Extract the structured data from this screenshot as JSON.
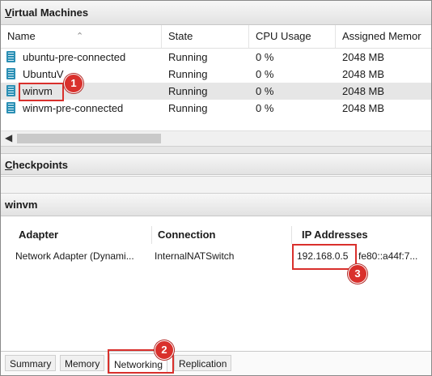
{
  "vm_pane": {
    "title_first": "V",
    "title_rest": "irtual Machines",
    "columns": [
      "Name",
      "State",
      "CPU Usage",
      "Assigned Memor"
    ],
    "rows": [
      {
        "name": "ubuntu-pre-connected",
        "state": "Running",
        "cpu": "0 %",
        "memory": "2048 MB"
      },
      {
        "name": "UbuntuV",
        "state": "Running",
        "cpu": "0 %",
        "memory": "2048 MB"
      },
      {
        "name": "winvm",
        "state": "Running",
        "cpu": "0 %",
        "memory": "2048 MB"
      },
      {
        "name": "winvm-pre-connected",
        "state": "Running",
        "cpu": "0 %",
        "memory": "2048 MB"
      }
    ],
    "selected_index": 2
  },
  "checkpoints_pane": {
    "title_first": "C",
    "title_rest": "heckpoints"
  },
  "details": {
    "title": "winvm",
    "columns": [
      "Adapter",
      "Connection",
      "IP Addresses"
    ],
    "adapter": "Network Adapter (Dynami...",
    "connection": "InternalNATSwitch",
    "ipv4": "192.168.0.5",
    "ipv6": "fe80::a44f:7..."
  },
  "tabs": [
    "Summary",
    "Memory",
    "Networking",
    "Replication"
  ],
  "active_tab": "Networking",
  "callouts": [
    "1",
    "2",
    "3"
  ],
  "colors": {
    "callout": "#d9302c",
    "selected_row": "#e6e6e6"
  },
  "icons": {
    "vm": "vm-icon",
    "scroll_left": "◀"
  }
}
